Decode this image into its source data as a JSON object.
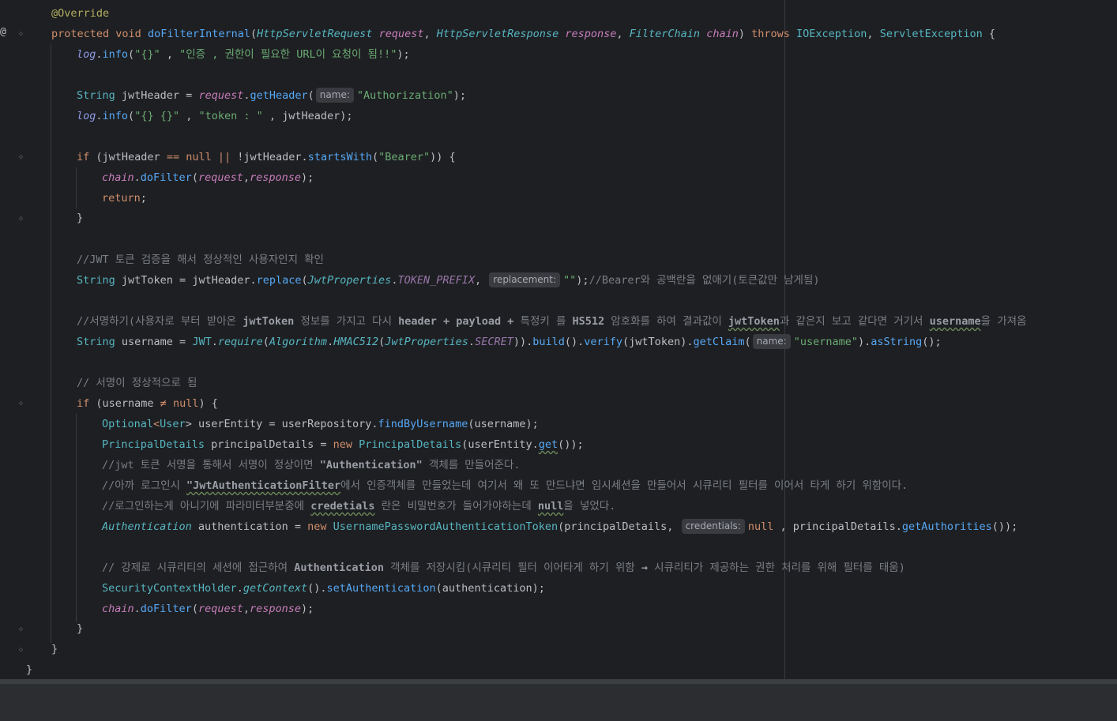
{
  "colors": {
    "background": "#1e1f22",
    "keyword": "#cf8e6d",
    "string": "#6aab73",
    "method": "#56a8f5",
    "comment": "#7a7e85",
    "annotation": "#b3ae60"
  },
  "gutter": {
    "override_marker": "@"
  },
  "lines": {
    "l1": [
      "@Override"
    ],
    "l2": [
      "protected",
      " ",
      "void",
      " ",
      "doFilterInternal",
      "(",
      "HttpServletRequest",
      " ",
      "request",
      ", ",
      "HttpServletResponse",
      " ",
      "response",
      ", ",
      "FilterChain",
      " ",
      "chain",
      ") ",
      "throws",
      " ",
      "IOException",
      ", ",
      "ServletException",
      " {"
    ],
    "l3": [
      "log",
      ".",
      "info",
      "(",
      "\"{}\"",
      " , ",
      "\"인증 , 권한이 필요한 URL이 요청이 됨!!\"",
      ");"
    ],
    "l5": [
      "String",
      " jwtHeader = ",
      "request",
      ".",
      "getHeader",
      "(",
      "name:",
      "\"Authorization\"",
      ");"
    ],
    "l6": [
      "log",
      ".",
      "info",
      "(",
      "\"{} {}\"",
      " , ",
      "\"token : \"",
      " , jwtHeader);"
    ],
    "l8": [
      "if",
      " (jwtHeader ",
      "==",
      " ",
      "null",
      " ",
      "||",
      " !jwtHeader.",
      "startsWith",
      "(",
      "\"Bearer\"",
      ")) {"
    ],
    "l9": [
      "chain",
      ".",
      "doFilter",
      "(",
      "request",
      ",",
      "response",
      ");"
    ],
    "l10": [
      "return",
      ";"
    ],
    "l11": [
      "}"
    ],
    "l13": [
      "//JWT 토큰 검증을 해서 정상적인 사용자인지 확인"
    ],
    "l14": [
      "String",
      " jwtToken = jwtHeader.",
      "replace",
      "(",
      "JwtProperties",
      ".",
      "TOKEN_PREFIX",
      ", ",
      "replacement:",
      "\"\"",
      ");",
      "//Bearer와 공백란을 없애기(토큰값만 남게됨)"
    ],
    "l16": [
      "//서명하기(사용자로 부터 받아온 ",
      "jwtToken",
      " 정보를 가지고 다시 ",
      "header + payload +",
      " 특정키 를 ",
      "HS512",
      " 암호화를 하여 결과값이 ",
      "jwtToken",
      "과 같은지 보고 같다면 거기서 ",
      "username",
      "을 가져옴"
    ],
    "l17": [
      "String",
      " username = ",
      "JWT",
      ".",
      "require",
      "(",
      "Algorithm",
      ".",
      "HMAC512",
      "(",
      "JwtProperties",
      ".",
      "SECRET",
      ")).",
      "build",
      "().",
      "verify",
      "(jwtToken).",
      "getClaim",
      "(",
      "name:",
      "\"username\"",
      ").",
      "asString",
      "();"
    ],
    "l19": [
      "// 서명이 정상적으로 됨"
    ],
    "l20": [
      "if",
      " (username ",
      "≠",
      " ",
      "null",
      ") {"
    ],
    "l21": [
      "Optional",
      "<",
      "User",
      "> userEntity = userRepository.",
      "findByUsername",
      "(username);"
    ],
    "l22": [
      "PrincipalDetails",
      " principalDetails = ",
      "new",
      " ",
      "PrincipalDetails",
      "(userEntity.",
      "get",
      "());"
    ],
    "l23": [
      "//jwt 토큰 서명을 통해서 서명이 정상이면 ",
      "\"Authentication\"",
      " 객체를 만들어준다."
    ],
    "l24": [
      "//아까 로그인시 ",
      "\"JwtAuthenticationFilter",
      "에서 인증객체를 만들었는데 여기서 왜 또 만드냐면 임시세션을 만들어서 시큐리티 필터를 이어서 타게 하기 위함이다."
    ],
    "l25": [
      "//로그인하는게 아니기에 파라미터부분중에 ",
      "credetials",
      " 란은 비밀번호가 들어가야하는데 ",
      "null",
      "을 넣었다."
    ],
    "l26": [
      "Authentication",
      " authentication = ",
      "new",
      " ",
      "UsernamePasswordAuthenticationToken",
      "(principalDetails, ",
      "credentials:",
      "null",
      " , principalDetails.",
      "getAuthorities",
      "());"
    ],
    "l28": [
      "// 강제로 시큐리티의 세션에 접근하여 ",
      "Authentication",
      " 객체를 저장시킴(시큐리티 필터 이어타게 하기 위함 ",
      "→",
      " 시큐리티가 제공하는 권한 처리를 위해 필터를 태움)"
    ],
    "l29": [
      "SecurityContextHolder",
      ".",
      "getContext",
      "().",
      "setAuthentication",
      "(authentication);"
    ],
    "l30": [
      "chain",
      ".",
      "doFilter",
      "(",
      "request",
      ",",
      "response",
      ");"
    ],
    "l31": [
      "}"
    ],
    "l32": [
      "}"
    ],
    "l33": [
      "}"
    ]
  }
}
